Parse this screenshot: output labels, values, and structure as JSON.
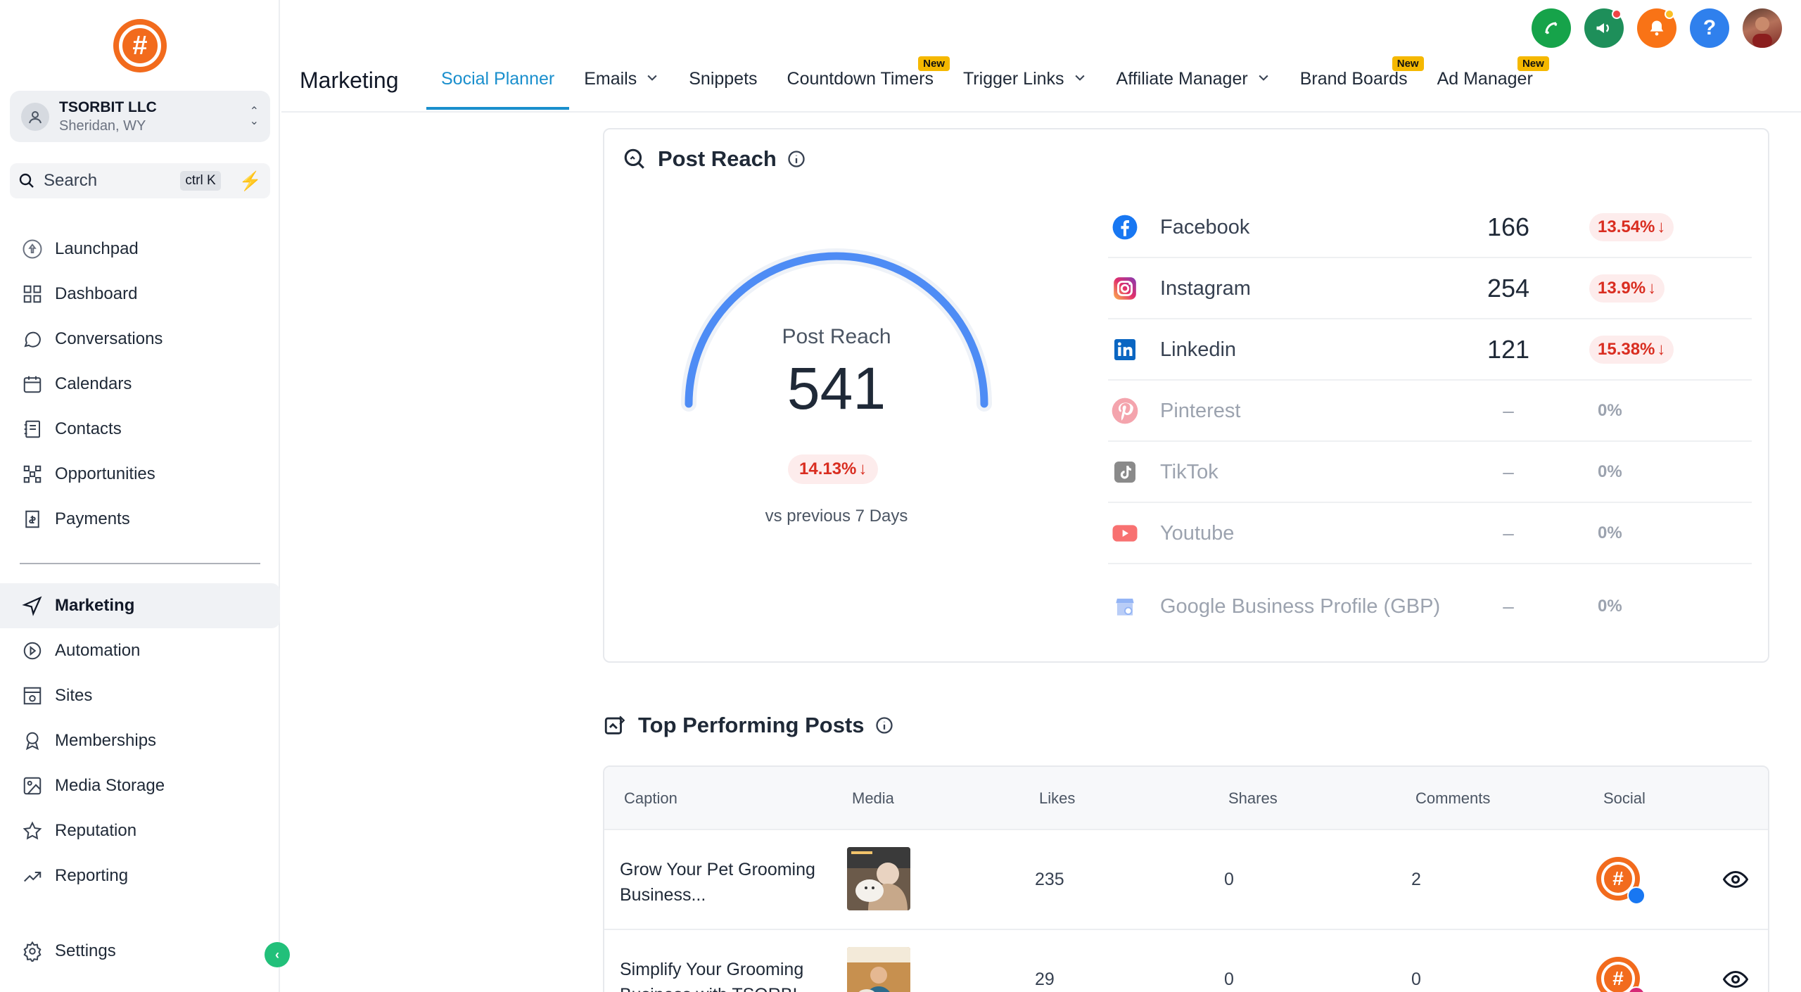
{
  "sidebar": {
    "account": {
      "name": "TSORBIT LLC",
      "location": "Sheridan, WY"
    },
    "search": {
      "label": "Search",
      "shortcut": "ctrl K"
    },
    "items": [
      {
        "label": "Launchpad",
        "icon": "rocket-icon"
      },
      {
        "label": "Dashboard",
        "icon": "grid-icon"
      },
      {
        "label": "Conversations",
        "icon": "chat-icon"
      },
      {
        "label": "Calendars",
        "icon": "calendar-icon"
      },
      {
        "label": "Contacts",
        "icon": "contacts-icon"
      },
      {
        "label": "Opportunities",
        "icon": "funnel-icon"
      },
      {
        "label": "Payments",
        "icon": "payments-icon"
      }
    ],
    "items2": [
      {
        "label": "Marketing",
        "icon": "send-icon"
      },
      {
        "label": "Automation",
        "icon": "automation-icon"
      },
      {
        "label": "Sites",
        "icon": "sites-icon"
      },
      {
        "label": "Memberships",
        "icon": "award-icon"
      },
      {
        "label": "Media Storage",
        "icon": "image-icon"
      },
      {
        "label": "Reputation",
        "icon": "star-icon"
      },
      {
        "label": "Reporting",
        "icon": "trend-icon"
      }
    ],
    "settings": "Settings",
    "active": "Marketing"
  },
  "header": {
    "title": "Marketing",
    "tabs": [
      {
        "label": "Social Planner",
        "active": true
      },
      {
        "label": "Emails",
        "dropdown": true
      },
      {
        "label": "Snippets"
      },
      {
        "label": "Countdown Timers",
        "badge": "New"
      },
      {
        "label": "Trigger Links",
        "dropdown": true
      },
      {
        "label": "Affiliate Manager",
        "dropdown": true
      },
      {
        "label": "Brand Boards",
        "badge": "New"
      },
      {
        "label": "Ad Manager",
        "badge": "New"
      }
    ],
    "icons": [
      {
        "name": "phone-icon",
        "color": "#16a34a"
      },
      {
        "name": "megaphone-icon",
        "color": "#1e8f5a"
      },
      {
        "name": "bell-icon",
        "color": "#f97316"
      },
      {
        "name": "help-icon",
        "color": "#2f80ed"
      }
    ]
  },
  "post_reach": {
    "title": "Post Reach",
    "gauge_label": "Post Reach",
    "total": "541",
    "gauge_fill": 1.0,
    "change": "14.13%",
    "comparison": "vs previous 7 Days",
    "platforms": [
      {
        "name": "Facebook",
        "value": "166",
        "change": "13.54%",
        "trend": "down",
        "icon": "facebook-icon",
        "color": "#1877f2"
      },
      {
        "name": "Instagram",
        "value": "254",
        "change": "13.9%",
        "trend": "down",
        "icon": "instagram-icon",
        "color": "#e1306c"
      },
      {
        "name": "Linkedin",
        "value": "121",
        "change": "15.38%",
        "trend": "down",
        "icon": "linkedin-icon",
        "color": "#0a66c2"
      },
      {
        "name": "Pinterest",
        "value": "–",
        "change": "0%",
        "trend": "none",
        "icon": "pinterest-icon",
        "color": "#e60023"
      },
      {
        "name": "TikTok",
        "value": "–",
        "change": "0%",
        "trend": "none",
        "icon": "tiktok-icon",
        "color": "#111111"
      },
      {
        "name": "Youtube",
        "value": "–",
        "change": "0%",
        "trend": "none",
        "icon": "youtube-icon",
        "color": "#ff0000"
      },
      {
        "name": "Google Business Profile (GBP)",
        "value": "–",
        "change": "0%",
        "trend": "none",
        "icon": "gbp-icon",
        "color": "#4285f4"
      }
    ]
  },
  "top_posts": {
    "title": "Top Performing Posts",
    "columns": [
      "Caption",
      "Media",
      "Likes",
      "Shares",
      "Comments",
      "Social"
    ],
    "rows": [
      {
        "caption": "Grow Your Pet Grooming Business...",
        "likes": "235",
        "shares": "0",
        "comments": "2",
        "network": "facebook"
      },
      {
        "caption": "Simplify Your Grooming Business with TSORBI...",
        "likes": "29",
        "shares": "0",
        "comments": "0",
        "network": "instagram"
      }
    ]
  }
}
